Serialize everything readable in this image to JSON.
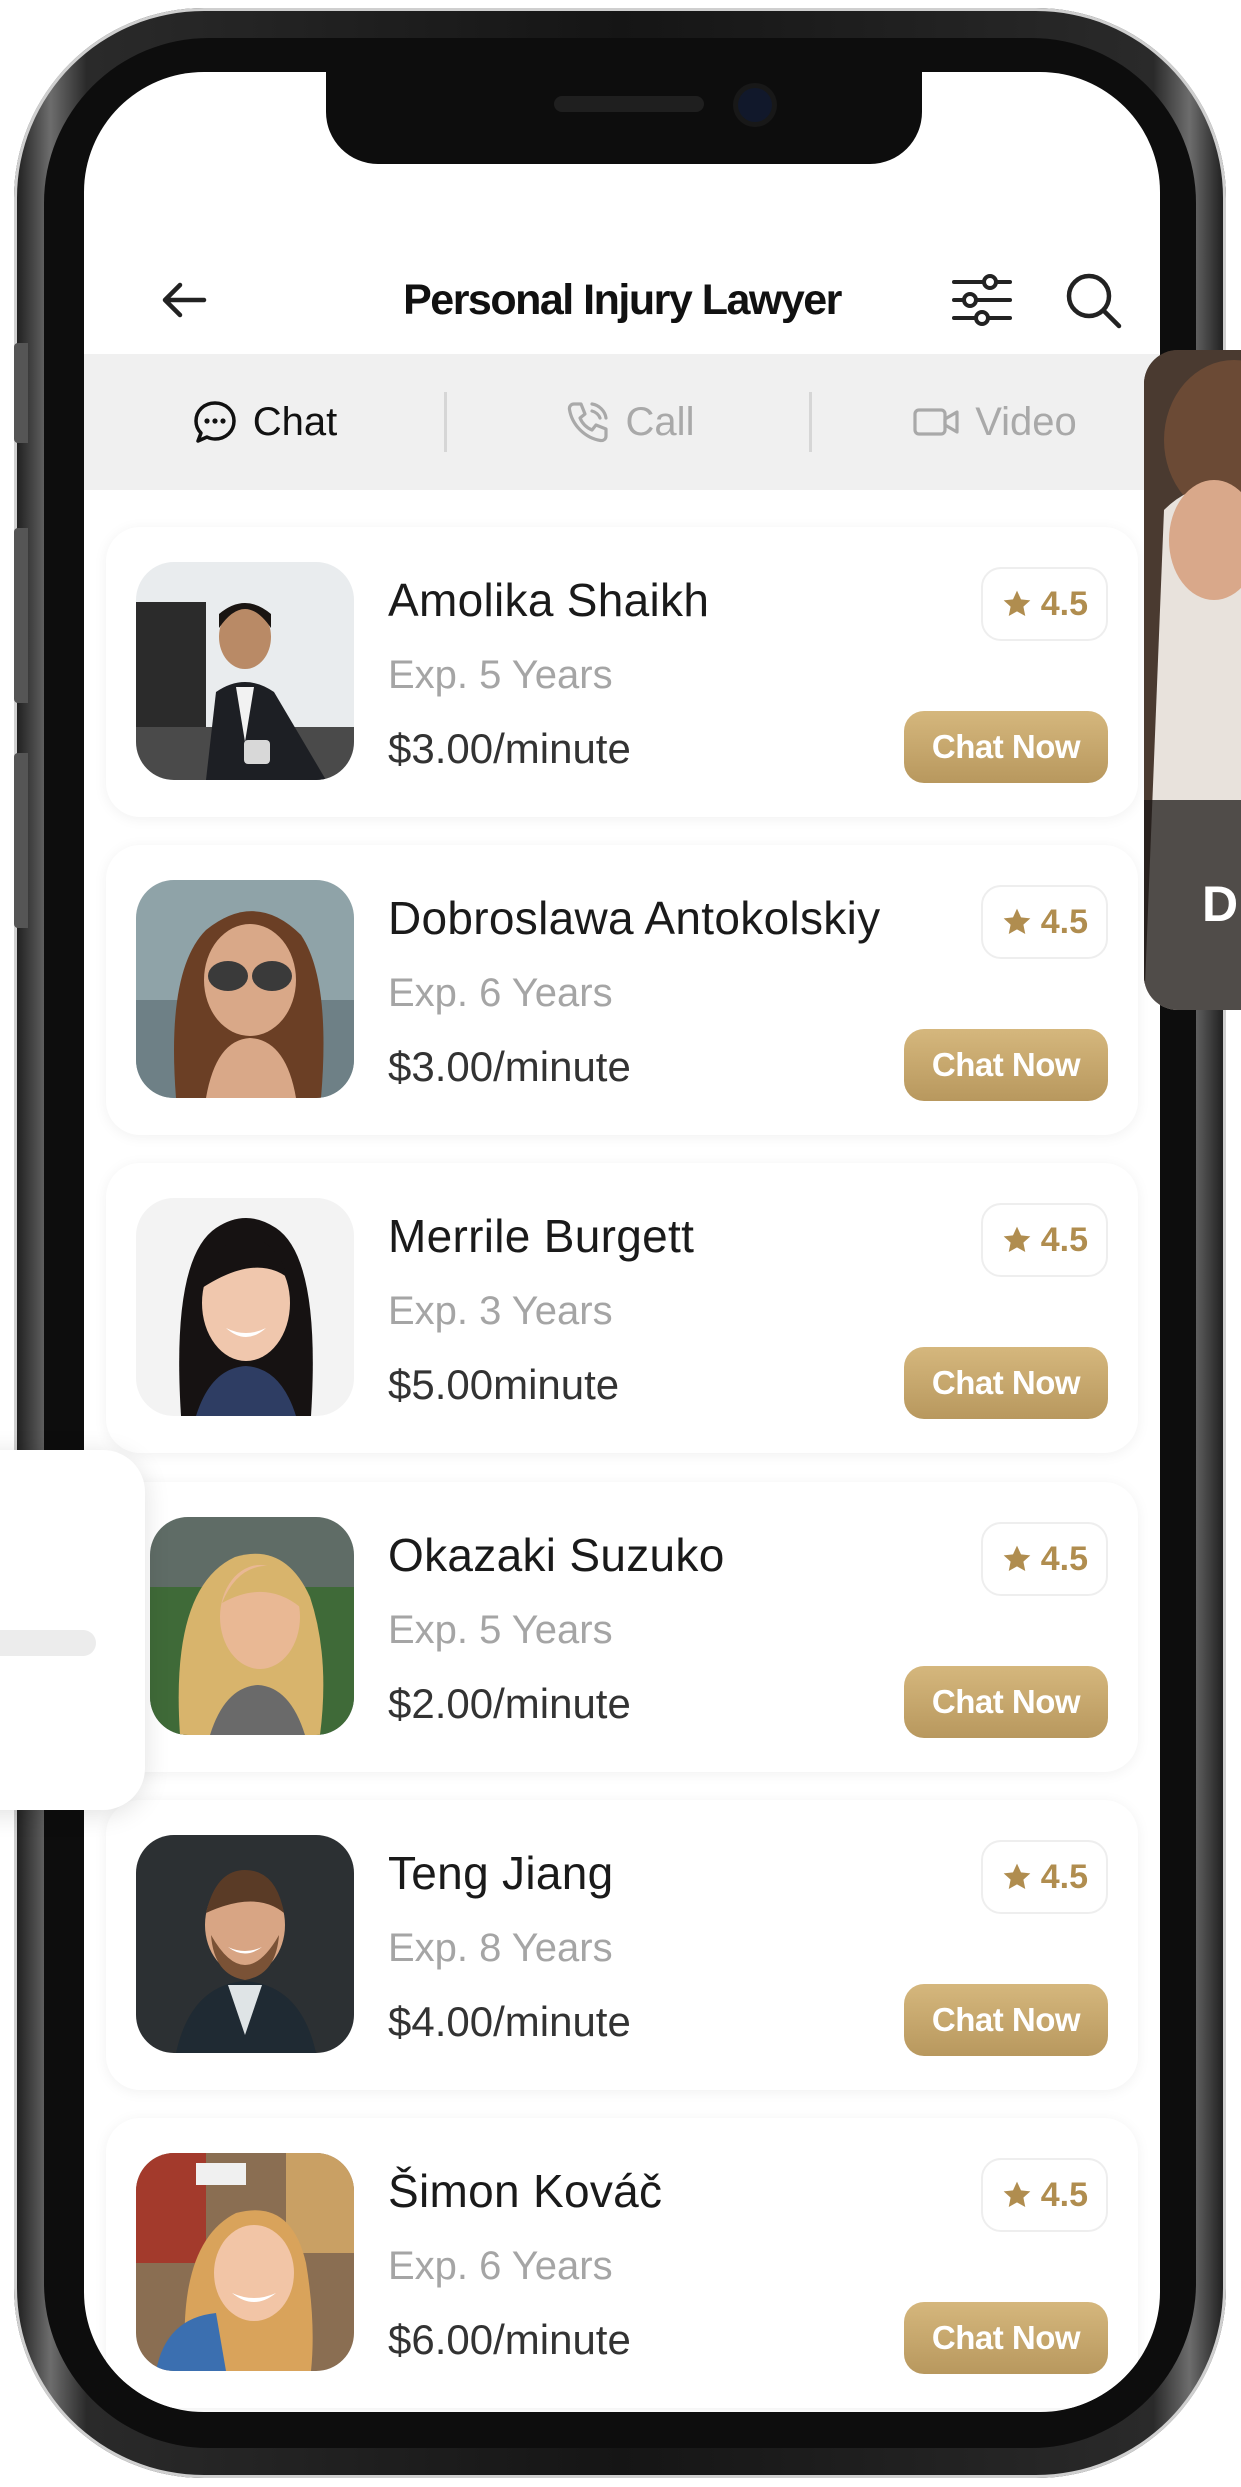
{
  "header": {
    "title": "Personal Injury Lawyer",
    "back_icon": "arrow-left-icon",
    "filter_icon": "sliders-icon",
    "search_icon": "search-icon"
  },
  "tabs": [
    {
      "label": "Chat",
      "icon": "chat-bubble-icon",
      "active": true
    },
    {
      "label": "Call",
      "icon": "phone-icon",
      "active": false
    },
    {
      "label": "Video",
      "icon": "video-icon",
      "active": false
    }
  ],
  "lawyers": [
    {
      "name": "Amolika Shaikh",
      "experience": "Exp. 5 Years",
      "price": "$3.00/minute",
      "rating": "4.5",
      "action": "Chat Now"
    },
    {
      "name": "Dobroslawa Antokolskiy",
      "experience": "Exp. 6 Years",
      "price": "$3.00/minute",
      "rating": "4.5",
      "action": "Chat Now"
    },
    {
      "name": "Merrile Burgett",
      "experience": "Exp. 3 Years",
      "price": "$5.00minute",
      "rating": "4.5",
      "action": "Chat Now"
    },
    {
      "name": "Okazaki Suzuko",
      "experience": "Exp. 5 Years",
      "price": "$2.00/minute",
      "rating": "4.5",
      "action": "Chat Now"
    },
    {
      "name": "Teng Jiang",
      "experience": "Exp. 8 Years",
      "price": "$4.00/minute",
      "rating": "4.5",
      "action": "Chat Now"
    },
    {
      "name": "Šimon Kováč",
      "experience": "Exp. 6 Years",
      "price": "$6.00/minute",
      "rating": "4.5",
      "action": "Chat Now"
    }
  ],
  "peek_right_letter": "D",
  "colors": {
    "accent": "#c4a46b",
    "accent_text": "#b08d4f",
    "tab_bg": "#f0f0f0"
  }
}
